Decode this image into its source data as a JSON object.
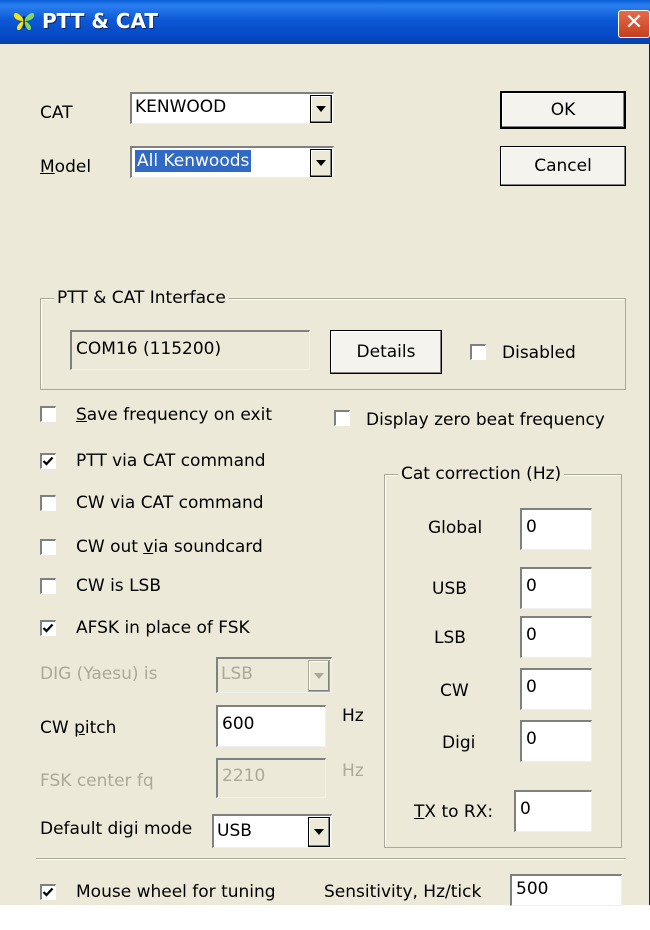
{
  "window": {
    "title": "PTT & CAT",
    "close_glyph": "✕"
  },
  "buttons": {
    "ok": "OK",
    "cancel": "Cancel",
    "details": "Details"
  },
  "cat": {
    "label": "CAT",
    "value": "KENWOOD"
  },
  "model": {
    "label_prefix": "",
    "label_ul": "M",
    "label_rest": "odel",
    "value": "All Kenwoods"
  },
  "interface": {
    "legend": "PTT & CAT Interface",
    "port": "COM16 (115200)",
    "disabled_label": "Disabled",
    "disabled_checked": false
  },
  "options": {
    "save_freq": {
      "ul": "S",
      "rest": "ave frequency on exit",
      "checked": false
    },
    "zero_beat": {
      "label": "Display zero beat frequency",
      "checked": false
    },
    "ptt_via_cat": {
      "label": "PTT via CAT command",
      "checked": true
    },
    "cw_via_cat": {
      "label": "CW via CAT command",
      "checked": false
    },
    "cw_out": {
      "pre": "CW out ",
      "ul": "v",
      "rest": "ia soundcard",
      "checked": false
    },
    "cw_lsb": {
      "label": "CW is LSB",
      "checked": false
    },
    "afsk": {
      "label": "AFSK in place of FSK",
      "checked": true
    }
  },
  "dig_yaesu": {
    "label": "DIG (Yaesu) is",
    "value": "LSB"
  },
  "cw_pitch": {
    "pre": "CW ",
    "ul": "p",
    "rest": "itch",
    "value": "600",
    "unit": "Hz"
  },
  "fsk_center": {
    "label": "FSK center fq",
    "value": "2210",
    "unit": "Hz"
  },
  "default_digi": {
    "label": "Default digi mode",
    "value": "USB"
  },
  "cat_correction": {
    "legend": "Cat correction (Hz)",
    "global": {
      "label": "Global",
      "value": "0"
    },
    "usb": {
      "label": "USB",
      "value": "0"
    },
    "lsb": {
      "label": "LSB",
      "value": "0"
    },
    "cw": {
      "label": "CW",
      "value": "0"
    },
    "digi": {
      "label": "Digi",
      "value": "0"
    },
    "tx_rx": {
      "ul": "T",
      "rest": "X to RX:",
      "value": "0"
    }
  },
  "mouse_wheel": {
    "label": "Mouse wheel for tuning",
    "checked": true
  },
  "sensitivity": {
    "label": "Sensitivity, Hz/tick",
    "value": "500"
  },
  "colors": {
    "titlebar": "#0a5fd8",
    "dialog_bg": "#ece9d8",
    "selection": "#316ac5",
    "close": "#c4401e"
  },
  "icons": {
    "app": "butterfly-icon",
    "close": "close-icon",
    "check": "check-mark-icon",
    "dropdown": "chevron-down-icon"
  }
}
